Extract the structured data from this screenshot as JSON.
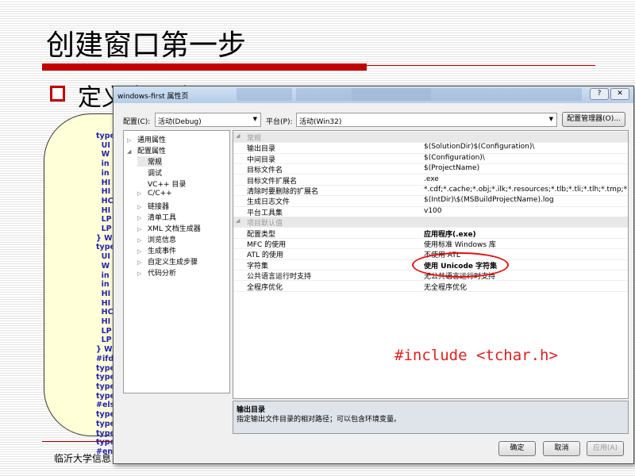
{
  "slide": {
    "title": "创建窗口第一步",
    "bullet": "定义窗口类",
    "footer": "临沂大学信息",
    "code_lines": [
      "type",
      "  UI",
      "  W",
      "  in",
      "  in",
      "  HI",
      "  HI",
      "  HC",
      "  HI",
      "  LP",
      "  LP",
      "} WI",
      "type",
      "  UI",
      "  W",
      "  in",
      "  in",
      "  HI",
      "  HI",
      "  HC",
      "  HI",
      "  LP",
      "  LP",
      "} WI",
      "#ifd",
      "type",
      "type",
      "type",
      "type",
      "#els",
      "type",
      "type",
      "type",
      "type",
      "#en"
    ],
    "annotation": "#include <tchar.h>"
  },
  "dialog": {
    "title": "windows-first 属性页",
    "help": "?",
    "close": "✕",
    "config_label": "配置(C):",
    "config_value": "活动(Debug)",
    "platform_label": "平台(P):",
    "platform_value": "活动(Win32)",
    "config_manager": "配置管理器(O)...",
    "tree": [
      {
        "label": "通用属性",
        "arrow": "▷"
      },
      {
        "label": "配置属性",
        "arrow": "◢"
      },
      {
        "label": "常规",
        "arrow": ""
      },
      {
        "label": "调试",
        "arrow": ""
      },
      {
        "label": "VC++ 目录",
        "arrow": ""
      },
      {
        "label": "C/C++",
        "arrow": "▷"
      },
      {
        "label": "链接器",
        "arrow": "▷"
      },
      {
        "label": "清单工具",
        "arrow": "▷"
      },
      {
        "label": "XML 文档生成器",
        "arrow": "▷"
      },
      {
        "label": "浏览信息",
        "arrow": "▷"
      },
      {
        "label": "生成事件",
        "arrow": "▷"
      },
      {
        "label": "自定义生成步骤",
        "arrow": "▷"
      },
      {
        "label": "代码分析",
        "arrow": "▷"
      }
    ],
    "grid": [
      {
        "cat": "常规"
      },
      {
        "n": "输出目录",
        "v": "$(SolutionDir)$(Configuration)\\"
      },
      {
        "n": "中间目录",
        "v": "$(Configuration)\\"
      },
      {
        "n": "目标文件名",
        "v": "$(ProjectName)"
      },
      {
        "n": "目标文件扩展名",
        "v": ".exe"
      },
      {
        "n": "清除时要删除的扩展名",
        "v": "*.cdf;*.cache;*.obj;*.ilk;*.resources;*.tlb;*.tli;*.tlh;*.tmp;*.rsp;*.pgc"
      },
      {
        "n": "生成日志文件",
        "v": "$(IntDir)\\$(MSBuildProjectName).log"
      },
      {
        "n": "平台工具集",
        "v": "v100"
      },
      {
        "cat": "项目默认值"
      },
      {
        "n": "配置类型",
        "v": "应用程序(.exe)",
        "bold": true
      },
      {
        "n": "MFC 的使用",
        "v": "使用标准 Windows 库"
      },
      {
        "n": "ATL 的使用",
        "v": "不使用 ATL"
      },
      {
        "n": "字符集",
        "v": "使用 Unicode 字符集",
        "bold": true
      },
      {
        "n": "公共语言运行时支持",
        "v": "无公共语言运行时支持"
      },
      {
        "n": "全程序优化",
        "v": "无全程序优化"
      }
    ],
    "desc_title": "输出目录",
    "desc_text": "指定输出文件目录的相对路径；可以包含环境变量。",
    "ok": "确定",
    "cancel": "取消",
    "apply": "应用(A)"
  }
}
